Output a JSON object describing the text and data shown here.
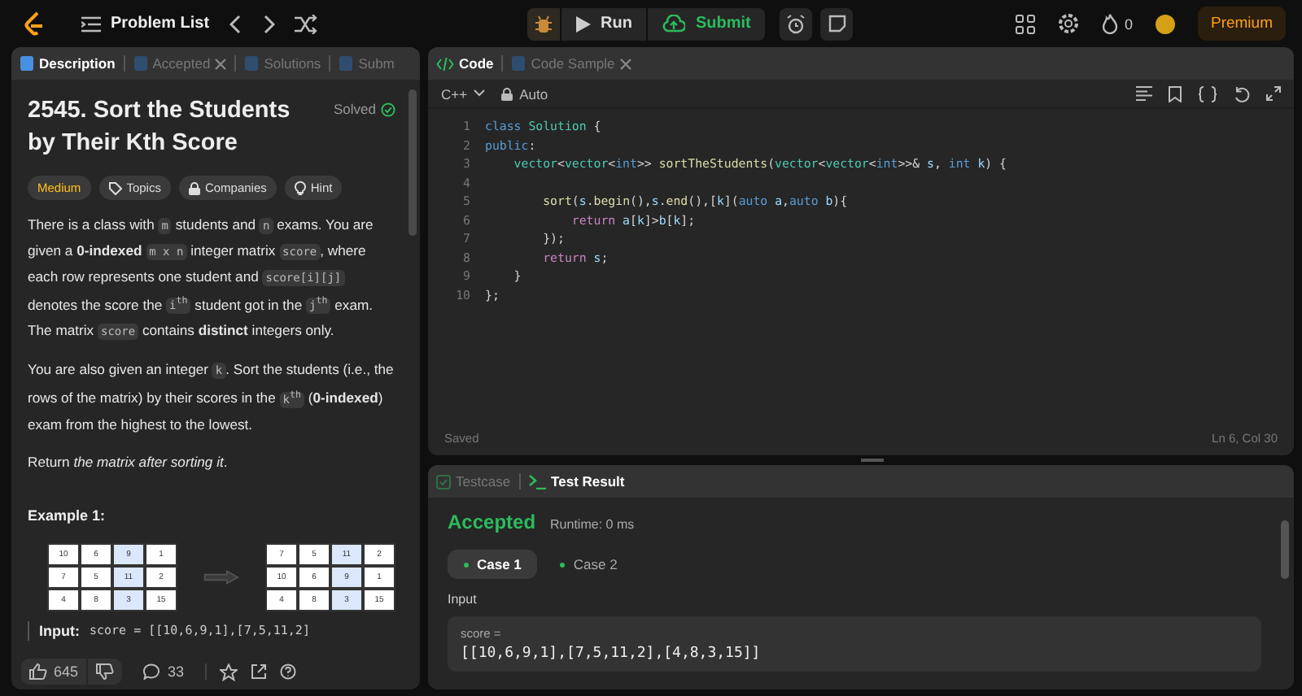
{
  "topbar": {
    "title": "Problem List",
    "run": "Run",
    "submit": "Submit",
    "streak": "0",
    "premium": "Premium"
  },
  "left_tabs": [
    {
      "label": "Description",
      "selected": true,
      "closable": false
    },
    {
      "label": "Accepted",
      "selected": false,
      "closable": true
    },
    {
      "label": "Solutions",
      "selected": false,
      "closable": false
    },
    {
      "label": "Subm",
      "selected": false,
      "closable": false
    }
  ],
  "problem": {
    "title": "2545. Sort the Students by Their Kth Score",
    "status": "Solved",
    "difficulty": "Medium",
    "chips": [
      "Topics",
      "Companies",
      "Hint"
    ],
    "paragraphs": [
      [
        {
          "kind": "text",
          "text": "There is a class with "
        },
        {
          "kind": "code",
          "text": "m"
        },
        {
          "kind": "text",
          "text": " students and "
        },
        {
          "kind": "code",
          "text": "n"
        },
        {
          "kind": "text",
          "text": " exams. You are given a **0-indexed** "
        },
        {
          "kind": "code",
          "text": "m x n"
        },
        {
          "kind": "text",
          "text": " integer matrix "
        },
        {
          "kind": "code",
          "text": "score"
        },
        {
          "kind": "text",
          "text": ", where each row represents one student and "
        },
        {
          "kind": "code",
          "text": "score[i][j]"
        },
        {
          "kind": "text",
          "text": " denotes the score the "
        },
        {
          "kind": "code",
          "text": "i$^{th}$"
        },
        {
          "kind": "text",
          "text": " student got in the "
        },
        {
          "kind": "code",
          "text": "j$^{th}$"
        },
        {
          "kind": "text",
          "text": " exam. The matrix "
        },
        {
          "kind": "code",
          "text": "score"
        },
        {
          "kind": "text",
          "text": " contains **distinct** integers only."
        }
      ],
      [
        {
          "kind": "text",
          "text": "You are also given an integer "
        },
        {
          "kind": "code",
          "text": "k"
        },
        {
          "kind": "text",
          "text": ". Sort the students (i.e., the rows of the matrix) by their scores in the "
        },
        {
          "kind": "code",
          "text": "k$^{th}$"
        },
        {
          "kind": "text",
          "text": " (**0-indexed**) exam from the highest to the lowest."
        }
      ],
      [
        {
          "kind": "text",
          "text": "Return *the matrix after sorting it*."
        }
      ]
    ],
    "example_title": "Example 1:",
    "matrices": [
      {
        "highlighted": [
          false,
          false,
          true,
          false
        ],
        "rows": [
          [
            "10",
            "6",
            "9",
            "1"
          ],
          [
            "7",
            "5",
            "11",
            "2"
          ],
          [
            "4",
            "8",
            "3",
            "15"
          ]
        ]
      },
      {
        "highlighted": [
          false,
          false,
          true,
          false
        ],
        "rows": [
          [
            "7",
            "5",
            "11",
            "2"
          ],
          [
            "10",
            "6",
            "9",
            "1"
          ],
          [
            "4",
            "8",
            "3",
            "15"
          ]
        ]
      }
    ],
    "input_label": "Input:",
    "input_value": "score = [[10,6,9,1],[7,5,11,2]"
  },
  "footer": {
    "likes": "645",
    "comments": "33"
  },
  "right_tabs": [
    {
      "label": "Code",
      "selected": true,
      "closable": false
    },
    {
      "label": "Code Sample",
      "selected": false,
      "closable": true
    }
  ],
  "editor": {
    "language": "C++",
    "mode": "Auto",
    "status": "Saved",
    "cursor": "Ln 6, Col 30",
    "lines": [
      {
        "num": "1",
        "tokens": [
          {
            "kind": "kw",
            "text": "class "
          },
          {
            "kind": "type",
            "text": "Solution"
          },
          {
            "kind": "plain",
            "text": " {"
          }
        ]
      },
      {
        "num": "2",
        "tokens": [
          {
            "kind": "kw",
            "text": "public"
          },
          {
            "kind": "plain",
            "text": ":"
          }
        ]
      },
      {
        "num": "3",
        "tokens": [
          {
            "kind": "type",
            "text": "    vector"
          },
          {
            "kind": "plain",
            "text": "<"
          },
          {
            "kind": "type",
            "text": "vector"
          },
          {
            "kind": "plain",
            "text": "<"
          },
          {
            "kind": "kw",
            "text": "int"
          },
          {
            "kind": "plain",
            "text": ">> "
          },
          {
            "kind": "fn",
            "text": "sortTheStudents"
          },
          {
            "kind": "plain",
            "text": "("
          },
          {
            "kind": "type",
            "text": "vector"
          },
          {
            "kind": "plain",
            "text": "<"
          },
          {
            "kind": "type",
            "text": "vector"
          },
          {
            "kind": "plain",
            "text": "<"
          },
          {
            "kind": "kw",
            "text": "int"
          },
          {
            "kind": "plain",
            "text": ">>& "
          },
          {
            "kind": "var",
            "text": "s"
          },
          {
            "kind": "plain",
            "text": ", "
          },
          {
            "kind": "kw",
            "text": "int "
          },
          {
            "kind": "var",
            "text": "k"
          },
          {
            "kind": "plain",
            "text": ") {"
          }
        ]
      },
      {
        "num": "4"
      },
      {
        "num": "5",
        "tokens": [
          {
            "kind": "fn",
            "text": "        sort"
          },
          {
            "kind": "plain",
            "text": "("
          },
          {
            "kind": "var",
            "text": "s"
          },
          {
            "kind": "plain",
            "text": "."
          },
          {
            "kind": "fn",
            "text": "begin"
          },
          {
            "kind": "plain",
            "text": "(),"
          },
          {
            "kind": "var",
            "text": "s"
          },
          {
            "kind": "plain",
            "text": "."
          },
          {
            "kind": "fn",
            "text": "end"
          },
          {
            "kind": "plain",
            "text": "(),["
          },
          {
            "kind": "var",
            "text": "k"
          },
          {
            "kind": "plain",
            "text": "]("
          },
          {
            "kind": "kw",
            "text": "auto "
          },
          {
            "kind": "var",
            "text": "a"
          },
          {
            "kind": "plain",
            "text": ","
          },
          {
            "kind": "kw",
            "text": "auto "
          },
          {
            "kind": "var",
            "text": "b"
          },
          {
            "kind": "plain",
            "text": "){"
          }
        ]
      },
      {
        "num": "6",
        "tokens": [
          {
            "kind": "ctrl",
            "text": "            return "
          },
          {
            "kind": "var",
            "text": "a"
          },
          {
            "kind": "plain",
            "text": "["
          },
          {
            "kind": "var",
            "text": "k"
          },
          {
            "kind": "plain",
            "text": "]>"
          },
          {
            "kind": "var",
            "text": "b"
          },
          {
            "kind": "plain",
            "text": "["
          },
          {
            "kind": "var",
            "text": "k"
          },
          {
            "kind": "plain",
            "text": "];"
          }
        ]
      },
      {
        "num": "7",
        "tokens": [
          {
            "kind": "plain",
            "text": "        });"
          }
        ]
      },
      {
        "num": "8",
        "tokens": [
          {
            "kind": "ctrl",
            "text": "        return "
          },
          {
            "kind": "var",
            "text": "s"
          },
          {
            "kind": "plain",
            "text": ";"
          }
        ]
      },
      {
        "num": "9",
        "tokens": [
          {
            "kind": "plain",
            "text": "    }"
          }
        ]
      },
      {
        "num": "10",
        "tokens": [
          {
            "kind": "plain",
            "text": "};"
          }
        ]
      }
    ]
  },
  "bottom_tabs": [
    {
      "label": "Testcase",
      "selected": false
    },
    {
      "label": "Test Result",
      "selected": true
    }
  ],
  "result": {
    "verdict": "Accepted",
    "runtime": "Runtime: 0 ms",
    "cases": [
      {
        "label": "Case 1",
        "selected": true
      },
      {
        "label": "Case 2",
        "selected": false
      }
    ],
    "input_label": "Input",
    "var_name": "score =",
    "var_value": "[[10,6,9,1],[7,5,11,2],[4,8,3,15]]"
  }
}
